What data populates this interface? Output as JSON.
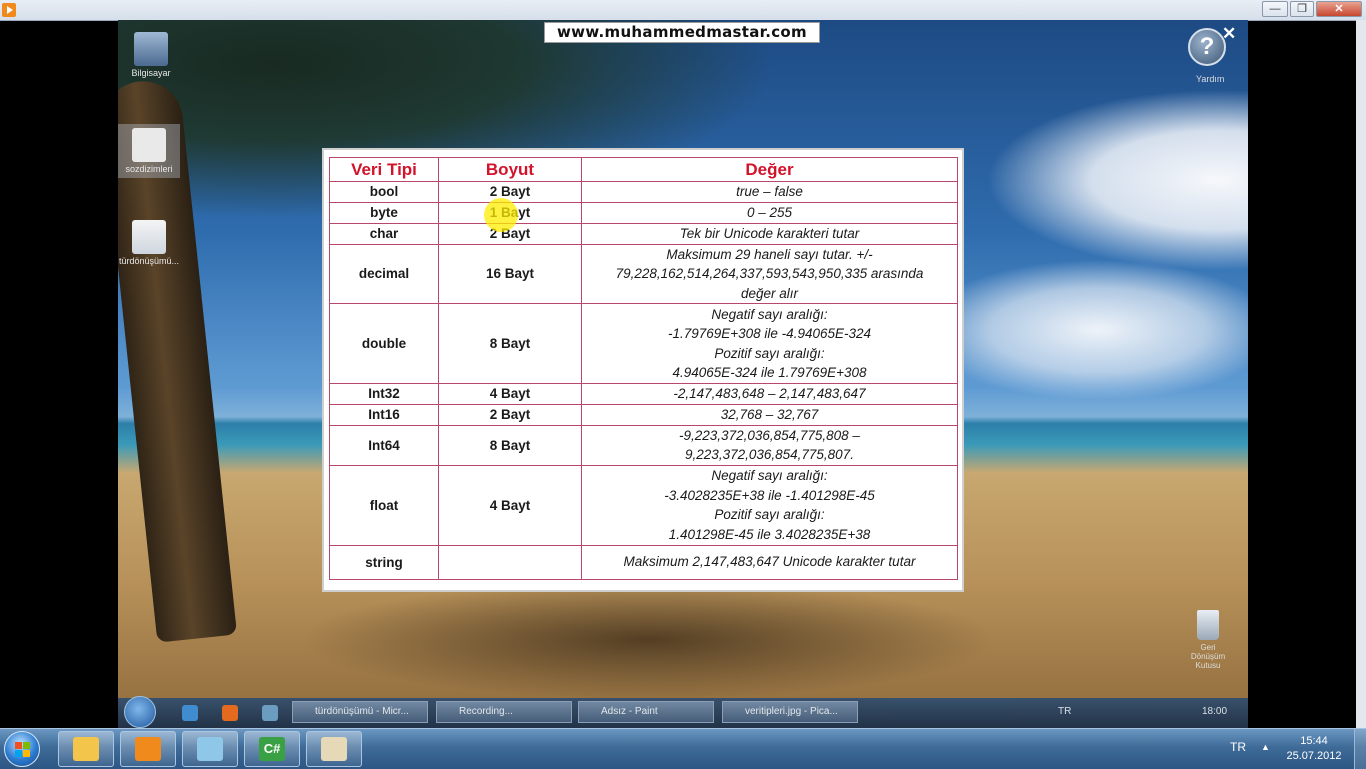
{
  "player": {
    "minimize_label": "—",
    "restore_label": "❐",
    "close_label": "✕"
  },
  "video": {
    "site_banner": "www.muhammedmastar.com",
    "desktop_icons": [
      {
        "label": "Bilgisayar"
      },
      {
        "label": "sozdizimleri"
      },
      {
        "label": "türdönüşümü..."
      }
    ],
    "help": {
      "glyph": "?",
      "label": "Yardım"
    },
    "overlay_close": "✕",
    "recycle_bin_label": "Geri Dönüşüm Kutusu",
    "table": {
      "headers": [
        "Veri Tipi",
        "Boyut",
        "Değer"
      ],
      "rows": [
        {
          "type": "bool",
          "size": "2 Bayt",
          "value": [
            "true – false"
          ]
        },
        {
          "type": "byte",
          "size": "1 Bayt",
          "value": [
            "0 – 255"
          ]
        },
        {
          "type": "char",
          "size": "2 Bayt",
          "value": [
            "Tek bir Unicode karakteri tutar"
          ]
        },
        {
          "type": "decimal",
          "size": "16 Bayt",
          "value": [
            "Maksimum 29 haneli sayı tutar. +/-",
            "79,228,162,514,264,337,593,543,950,335 arasında",
            "değer alır"
          ]
        },
        {
          "type": "double",
          "size": "8 Bayt",
          "value": [
            "Negatif sayı aralığı:",
            "-1.79769E+308 ile -4.94065E-324",
            "Pozitif sayı aralığı:",
            "4.94065E-324 ile 1.79769E+308"
          ]
        },
        {
          "type": "Int32",
          "size": "4 Bayt",
          "value": [
            "-2,147,483,648 – 2,147,483,647"
          ]
        },
        {
          "type": "Int16",
          "size": "2 Bayt",
          "value": [
            "32,768 – 32,767"
          ]
        },
        {
          "type": "Int64",
          "size": "8 Bayt",
          "value": [
            "-9,223,372,036,854,775,808 –",
            "9,223,372,036,854,775,807."
          ]
        },
        {
          "type": "float",
          "size": "4 Bayt",
          "value": [
            "Negatif sayı aralığı:",
            "-3.4028235E+38 ile -1.401298E-45",
            "Pozitif sayı aralığı:",
            "1.401298E-45 ile 3.4028235E+38"
          ]
        },
        {
          "type": "string",
          "size": "",
          "value": [
            "Maksimum 2,147,483,647 Unicode karakter tutar"
          ]
        }
      ]
    },
    "inner_taskbar": {
      "tasks": [
        "türdönüşümü - Micr...",
        "Recording...",
        "Adsız - Paint",
        "veritipleri.jpg - Pica..."
      ],
      "tray_lang": "TR",
      "tray_time": "18:00"
    }
  },
  "taskbar": {
    "pinned": [
      {
        "name": "explorer-icon",
        "color": "#f3c54a"
      },
      {
        "name": "media-player-icon",
        "color": "#f08a1d"
      },
      {
        "name": "notepad-icon",
        "color": "#8fc7e8"
      },
      {
        "name": "csharp-icon",
        "color": "#3aa044",
        "text": "C#"
      },
      {
        "name": "paint-icon",
        "color": "#e6d9b8"
      }
    ],
    "tray": {
      "language": "TR",
      "arrow": "▲",
      "time": "15:44",
      "date": "25.07.2012"
    }
  }
}
